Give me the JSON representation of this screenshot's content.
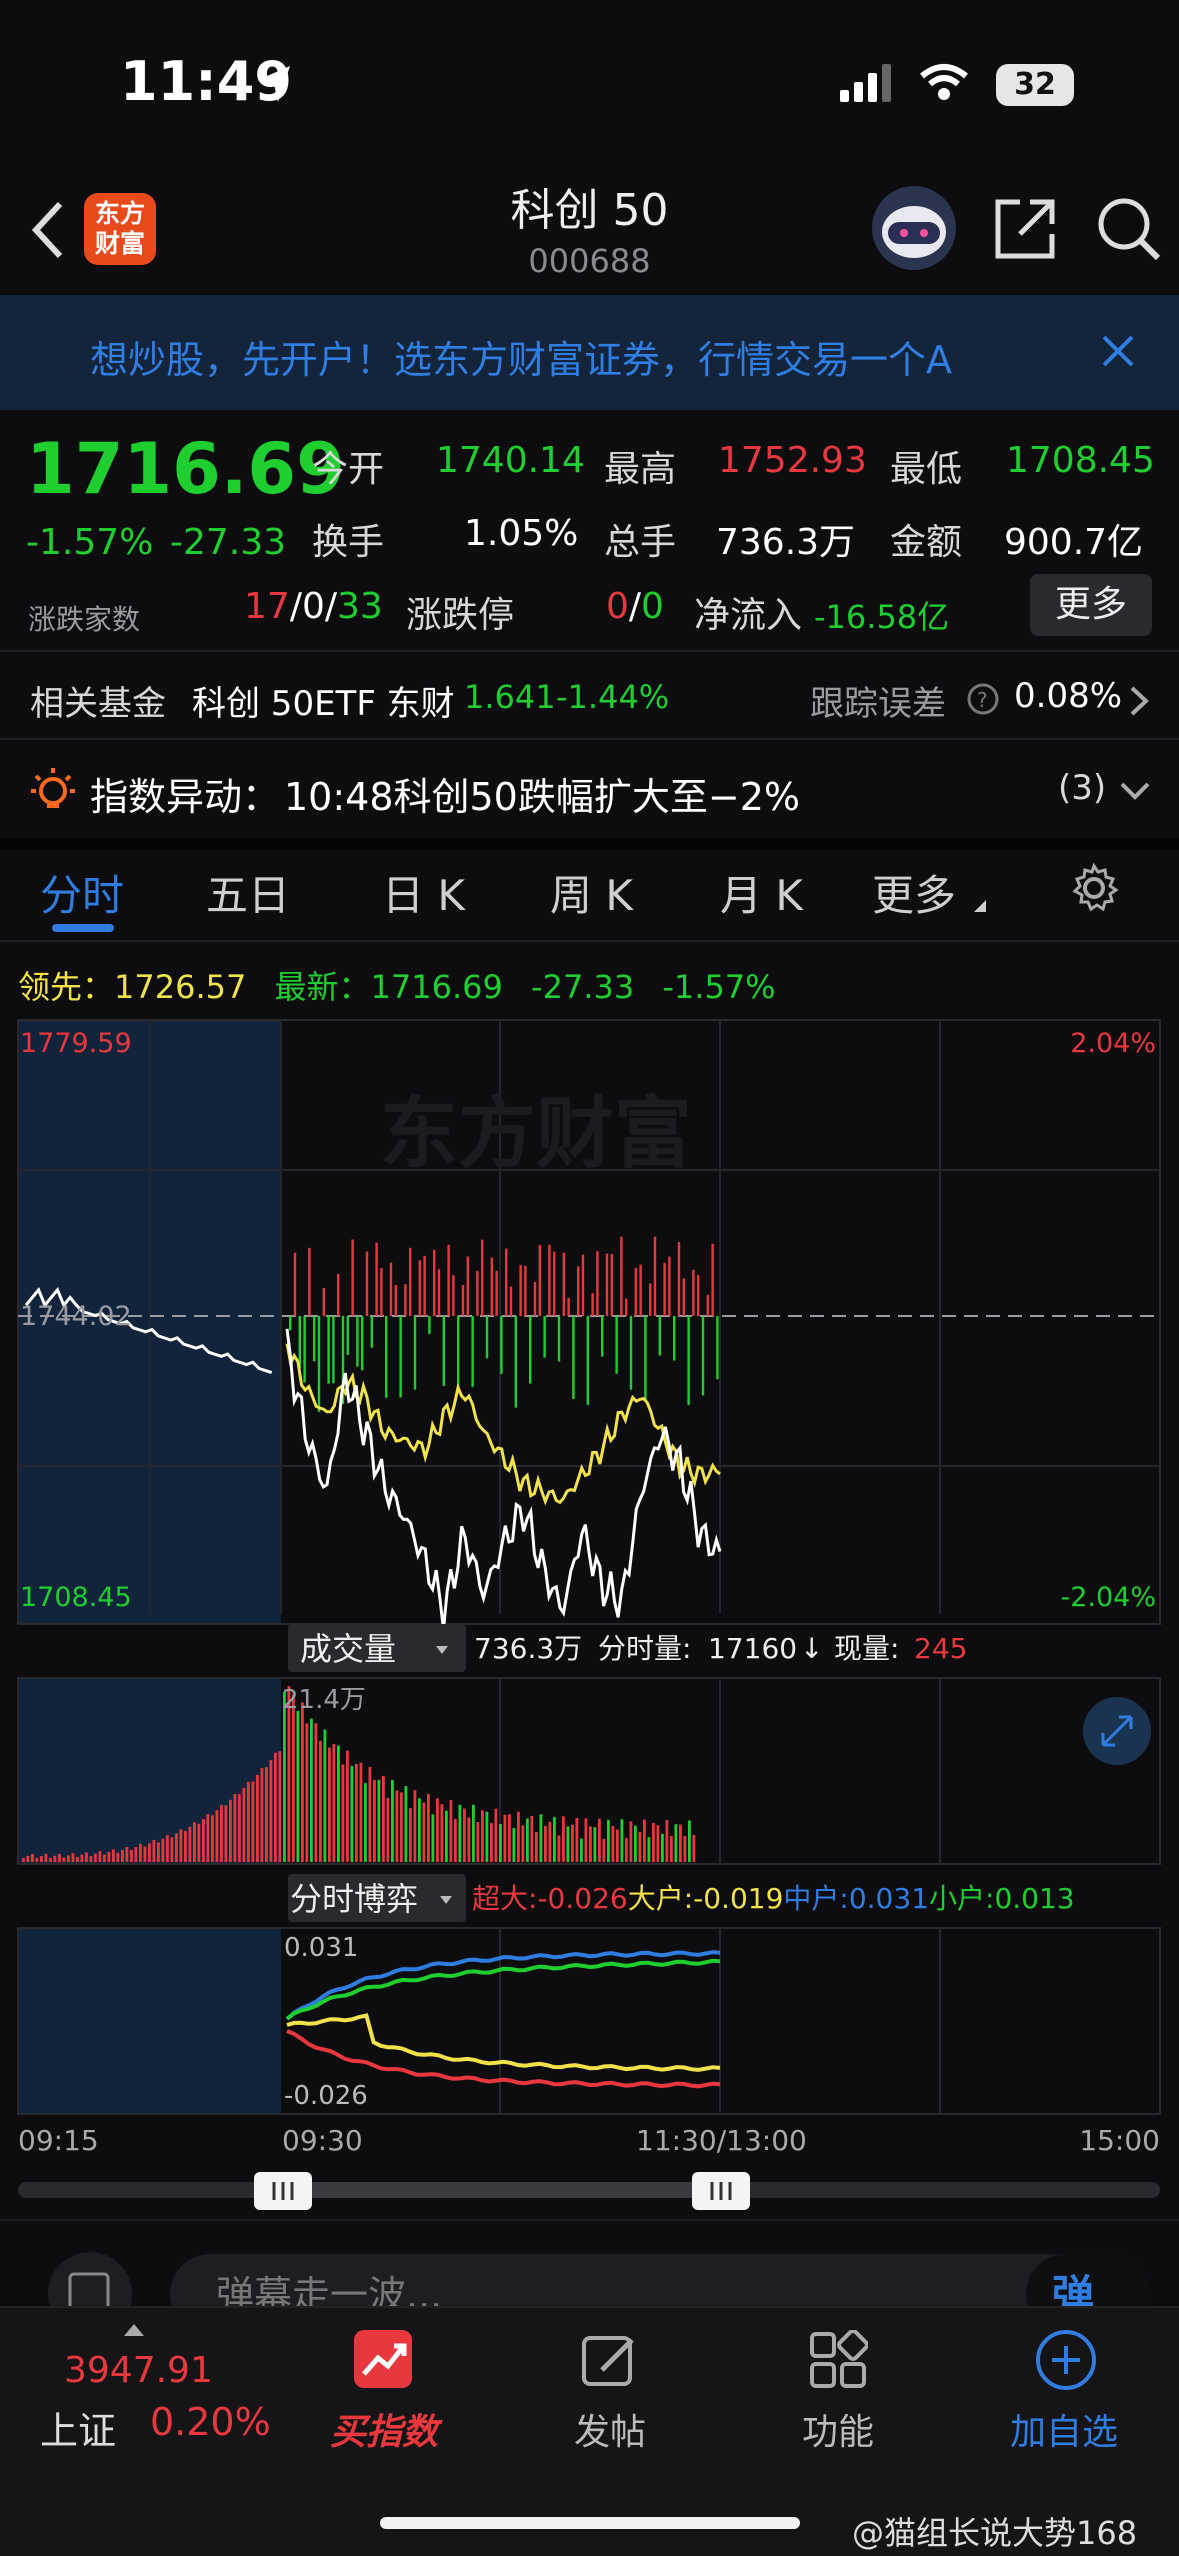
{
  "status": {
    "time": "11:49",
    "battery": "32"
  },
  "header": {
    "logo": "东方\n财富",
    "logo_line1": "东方",
    "logo_line2": "财富",
    "title": "科创 50",
    "code": "000688"
  },
  "banner": {
    "text": "想炒股，先开户！选东方财富证券，行情交易一个A"
  },
  "quote": {
    "price": "1716.69",
    "change_pct": "-1.57%",
    "change": "-27.33",
    "open_label": "今开",
    "open": "1740.14",
    "high_label": "最高",
    "high": "1752.93",
    "low_label": "最低",
    "low": "1708.45",
    "turnover_label": "换手",
    "turnover": "1.05%",
    "volume_label": "总手",
    "volume": "736.3万",
    "amount_label": "金额",
    "amount": "900.7亿",
    "breadth_label": "涨跌家数",
    "up_count": "17",
    "sep1": "/",
    "flat_count": "0",
    "sep2": "/",
    "down_count": "33",
    "limit_label": "涨跌停",
    "limit_up": "0",
    "sep3": "/",
    "limit_down": "0",
    "netflow_label": "净流入",
    "netflow": "-16.58亿",
    "more_button": "更多"
  },
  "fund": {
    "label": "相关基金",
    "name": "科创 50ETF 东财",
    "price": "1.641",
    "change": "-1.44%",
    "tracking_label": "跟踪误差",
    "tracking_value": "0.08%"
  },
  "alert": {
    "label": "指数异动：",
    "text": "10:48科创50跌幅扩大至−2%",
    "count": "(3)"
  },
  "tabs": [
    "分时",
    "五日",
    "日 K",
    "周 K",
    "月 K",
    "更多"
  ],
  "intraday": {
    "leading_label": "领先：",
    "leading": "1726.57",
    "latest_label": "最新：",
    "latest": "1716.69",
    "latest_change": "-27.33",
    "latest_pct": "-1.57%",
    "y_top": "1779.59",
    "y_bottom": "1708.45",
    "y_mid": "1744.02",
    "pct_top": "2.04%",
    "pct_bottom": "-2.04%",
    "watermark": "东方财富"
  },
  "volume": {
    "selector": "成交量",
    "total": "736.3万",
    "period_label": "分时量:",
    "period": "17160",
    "arrow": "↓",
    "current_label": "现量:",
    "current": "245",
    "peak_label": "21.4万"
  },
  "flow": {
    "selector": "分时博弈",
    "super_label": "超大:",
    "super": "-0.026",
    "large_label": "大户:",
    "large": "-0.019",
    "mid_label": "中户:",
    "mid": "0.031",
    "small_label": "小户:",
    "small": "0.013",
    "y_top": "0.031",
    "y_bottom": "-0.026"
  },
  "time_axis": [
    "09:15",
    "09:30",
    "11:30/13:00",
    "15:00"
  ],
  "danmaku": {
    "placeholder": "弹幕走一波...",
    "send": "弹"
  },
  "bottom_nav": {
    "index_value": "3947.91",
    "index_name": "上证",
    "index_pct": "0.20%",
    "items": [
      "买指数",
      "发帖",
      "功能",
      "加自选"
    ]
  },
  "watermark_footer": "@猫组长说大势168",
  "colors": {
    "up": "#e8383d",
    "down": "#1fcf2f",
    "avg": "#f2e24a",
    "accent": "#2f7de0",
    "bg": "#0d0d10"
  },
  "chart_data": {
    "type": "line",
    "title": "",
    "ylim": [
      1708.45,
      1779.59
    ],
    "prev_close": 1744.02,
    "series": [
      {
        "name": "最新",
        "values": [
          1741.0,
          1730.5,
          1724.0,
          1737.5,
          1731.0,
          1724.5,
          1721.0,
          1716.0,
          1710.0,
          1719.0,
          1712.0,
          1718.0,
          1722.0,
          1715.0,
          1710.0,
          1719.5,
          1713.0,
          1711.0,
          1724.0,
          1731.0,
          1727.0,
          1719.0,
          1716.69
        ]
      },
      {
        "name": "领先",
        "values": [
          1741.5,
          1736.0,
          1733.0,
          1737.0,
          1735.0,
          1731.0,
          1730.0,
          1729.0,
          1733.0,
          1736.0,
          1731.0,
          1728.0,
          1725.0,
          1724.0,
          1723.0,
          1726.0,
          1729.0,
          1733.0,
          1735.5,
          1731.0,
          1727.0,
          1726.0,
          1726.57
        ]
      }
    ]
  }
}
